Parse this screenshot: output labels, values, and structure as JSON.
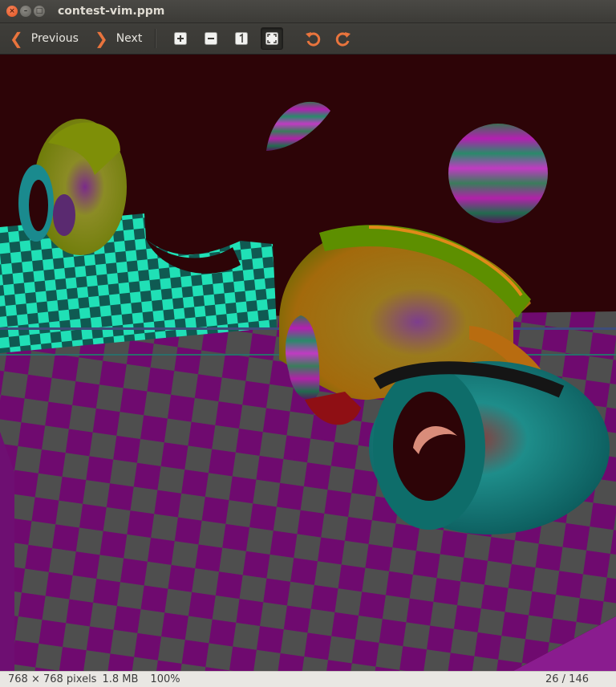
{
  "window": {
    "title": "contest-vim.ppm",
    "close_glyph": "×",
    "min_glyph": "–",
    "max_glyph": "□"
  },
  "toolbar": {
    "previous_label": "Previous",
    "next_label": "Next",
    "previous_icon": "chevron-left-icon",
    "next_icon": "chevron-right-icon",
    "tools": [
      "zoom-in-icon",
      "zoom-out-icon",
      "zoom-normal-icon",
      "zoom-fit-icon",
      "rotate-left-icon",
      "rotate-right-icon"
    ],
    "accent_color": "#e9743d"
  },
  "image": {
    "background_color": "#2d0407",
    "checker_colors": [
      "#6f0a6f",
      "#4e4e4e"
    ]
  },
  "status": {
    "dimensions": "768 × 768 pixels",
    "file_size": "1.8 MB",
    "zoom": "100%",
    "position": "26 / 146"
  }
}
